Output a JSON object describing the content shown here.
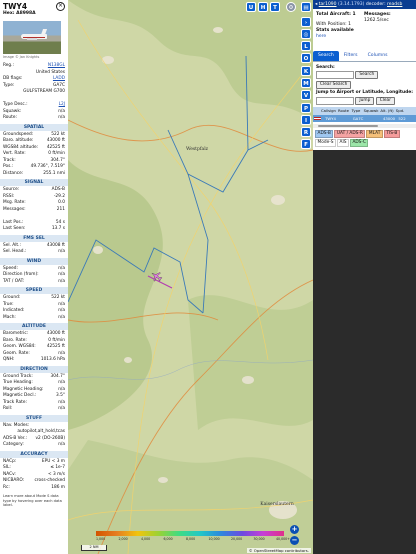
{
  "aircraft": {
    "callsign": "TWY4",
    "hex_label": "Hex:",
    "hex": "A8998A",
    "photo_credit": "Image © Jan Knights"
  },
  "reg_rows": [
    {
      "k": "Reg.:",
      "v": "N138GL",
      "link": true
    },
    {
      "k": "",
      "v": "United States",
      "link": false
    },
    {
      "k": "DB flags:",
      "v": "LADD",
      "link": true
    },
    {
      "k": "Type:",
      "v": "GA7C",
      "link": false
    },
    {
      "k": "",
      "v": "GULFSTREAM G700",
      "link": false
    },
    {
      "k": "",
      "v": "",
      "link": false
    },
    {
      "k": "Type Desc.:",
      "v": "L2J",
      "link": true
    },
    {
      "k": "Squawk:",
      "v": "n/a",
      "link": false
    },
    {
      "k": "Route:",
      "v": "n/a",
      "link": false
    }
  ],
  "sections": [
    {
      "title": "SPATIAL",
      "rows": [
        {
          "k": "Groundspeed:",
          "v": "522 kt"
        },
        {
          "k": "Baro. altitude:",
          "v": "43000 ft"
        },
        {
          "k": "WGS84 altitude:",
          "v": "42525 ft"
        },
        {
          "k": "Vert. Rate:",
          "v": "0 ft/min"
        },
        {
          "k": "Track:",
          "v": "304.7°"
        },
        {
          "k": "Pos.:",
          "v": "49.736°, 7.519°"
        },
        {
          "k": "Distance:",
          "v": "255.1 nmi"
        }
      ]
    },
    {
      "title": "SIGNAL",
      "rows": [
        {
          "k": "Source:",
          "v": "ADS-B"
        },
        {
          "k": "RSSI:",
          "v": "-29.2"
        },
        {
          "k": "Msg. Rate:",
          "v": "0.0"
        },
        {
          "k": "Messages:",
          "v": "211"
        },
        {
          "k": "",
          "v": ""
        },
        {
          "k": "Last Pos.:",
          "v": "54 s"
        },
        {
          "k": "Last Seen:",
          "v": "13.7 s"
        }
      ]
    },
    {
      "title": "FMS SEL",
      "rows": [
        {
          "k": "Sel. Alt.:",
          "v": "43008 ft"
        },
        {
          "k": "Sel. Head.:",
          "v": "n/a"
        }
      ]
    },
    {
      "title": "WIND",
      "rows": [
        {
          "k": "Speed:",
          "v": "n/a"
        },
        {
          "k": "Direction (from):",
          "v": "n/a"
        },
        {
          "k": "TAT / OAT:",
          "v": "n/a"
        }
      ]
    },
    {
      "title": "SPEED",
      "rows": [
        {
          "k": "Ground:",
          "v": "522 kt"
        },
        {
          "k": "True:",
          "v": "n/a"
        },
        {
          "k": "Indicated:",
          "v": "n/a"
        },
        {
          "k": "Mach:",
          "v": "n/a"
        }
      ]
    },
    {
      "title": "ALTITUDE",
      "rows": [
        {
          "k": "Barometric:",
          "v": "43000 ft"
        },
        {
          "k": "Baro. Rate:",
          "v": "0 ft/min"
        },
        {
          "k": "Geom. WGS84:",
          "v": "42525 ft"
        },
        {
          "k": "Geom. Rate:",
          "v": "n/a"
        },
        {
          "k": "QNH:",
          "v": "1013.6 hPa"
        }
      ]
    },
    {
      "title": "DIRECTION",
      "rows": [
        {
          "k": "Ground Track:",
          "v": "304.7°"
        },
        {
          "k": "True Heading:",
          "v": "n/a"
        },
        {
          "k": "Magnetic Heading:",
          "v": "n/a"
        },
        {
          "k": "Magnetic Decl.:",
          "v": "3.5°"
        },
        {
          "k": "Track Rate:",
          "v": "n/a"
        },
        {
          "k": "Roll:",
          "v": "n/a"
        }
      ]
    },
    {
      "title": "STUFF",
      "rows": [
        {
          "k": "Nav. Modes:",
          "v": ""
        },
        {
          "k": "",
          "v": "autopilot,alt_hold,tcas"
        },
        {
          "k": "ADS-B Ver.:",
          "v": "v2 (DO-260B)"
        },
        {
          "k": "Category:",
          "v": "n/a"
        }
      ]
    },
    {
      "title": "ACCURACY",
      "rows": [
        {
          "k": "NACp:",
          "v": "EPU < 3 m"
        },
        {
          "k": "SIL:",
          "v": "≤ 1e-7"
        },
        {
          "k": "NACv:",
          "v": "< 3 m/s"
        },
        {
          "k": "NICBARO:",
          "v": "cross-checked"
        },
        {
          "k": "Rc:",
          "v": "186 m"
        }
      ]
    }
  ],
  "footer": "Learn more about Mode S data type by hovering over each data label.",
  "map": {
    "top_buttons": [
      "U",
      "H",
      "T"
    ],
    "side_buttons": [
      "L",
      "O",
      "K",
      "M",
      "V",
      "P",
      "I",
      "R",
      "F"
    ],
    "places": [
      {
        "name": "Westpfalz"
      },
      {
        "name": "Kaiserslautern"
      }
    ],
    "zoom_in": "+",
    "zoom_out": "−",
    "altitude_labels": [
      "1,000",
      "2,000",
      "4,000",
      "6,000",
      "8,000",
      "10,000",
      "20,000",
      "30,000",
      "40,000+"
    ],
    "scale_label": "2 NM",
    "attribution": "© OpenStreetMap contributors."
  },
  "right": {
    "topbar_prefix": "◂",
    "topbar_link": "tar1090",
    "topbar_version": "(3.14.1793)",
    "topbar_suffix": "decoder:",
    "topbar_decoder": "readsb",
    "total_aircraft": "Total Aircraft: 1",
    "messages_label": "Messages:",
    "messages_rate": "1262.5/sec",
    "with_position": "With Position: 1",
    "stats": "Stats available",
    "stats_link": "here",
    "tabs": [
      "Search",
      "Filters",
      "Columns"
    ],
    "search_label": "Search:",
    "search_button": "Search",
    "clear_search": "Clear Search",
    "jump_label": "Jump to Airport or Latitude, Longitude:",
    "jump_button": "Jump",
    "clear_button": "Clear",
    "columns": [
      "",
      "Callsign",
      "Route",
      "Type",
      "Squawk",
      "Alt. (ft)",
      "Spd."
    ],
    "row": [
      "",
      "TWY4",
      "",
      "GA7C",
      "",
      "43000",
      "522"
    ],
    "legend": [
      {
        "label": "ADS-B",
        "color": "#9fc7f0"
      },
      {
        "label": "UAT / ADS-R",
        "color": "#f5a3a3"
      },
      {
        "label": "MLAT",
        "color": "#f5c07a"
      },
      {
        "label": "TIS-B",
        "color": "#f59b9b"
      },
      {
        "label": "Mode-S",
        "color": "#ffffff"
      },
      {
        "label": "AIS",
        "color": "#ffffff"
      },
      {
        "label": "ADS-C",
        "color": "#9be6a8"
      }
    ]
  }
}
